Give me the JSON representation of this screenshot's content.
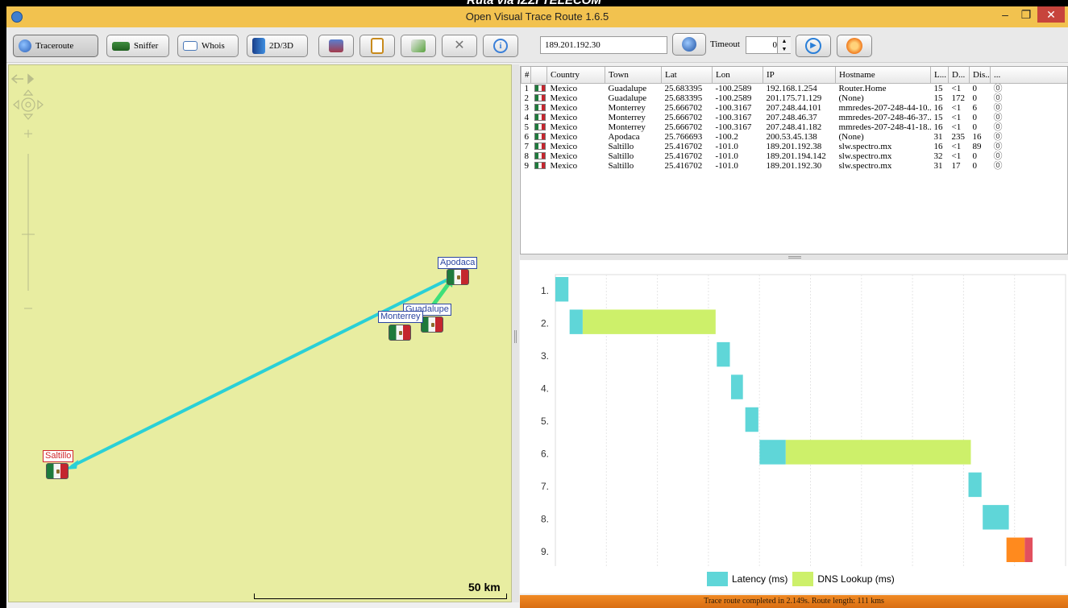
{
  "caption": "Ruta via IZZI TELECOM",
  "window": {
    "title": "Open Visual Trace Route 1.6.5",
    "minimize": "–",
    "maximize": "❐",
    "close": "✕"
  },
  "toolbar": {
    "traceroute_label": "Traceroute",
    "sniffer_label": "Sniffer",
    "whois_label": "Whois",
    "view_label": "2D/3D",
    "target_ip": "189.201.192.30",
    "timeout_label": "Timeout",
    "timeout_value": "0"
  },
  "map": {
    "scale_label": "50 km",
    "cities": {
      "apodaca": "Apodaca",
      "guadalupe": "Guadalupe",
      "monterrey": "Monterrey",
      "saltillo": "Saltillo"
    }
  },
  "table": {
    "columns": [
      "#",
      "",
      "Country",
      "Town",
      "Lat",
      "Lon",
      "IP",
      "Hostname",
      "L...",
      "D...",
      "Dis...",
      "..."
    ],
    "rows": [
      [
        "1",
        "Mexico",
        "Guadalupe",
        "25.683395",
        "-100.2589",
        "192.168.1.254",
        "Router.Home",
        "15",
        "<1",
        "0"
      ],
      [
        "2",
        "Mexico",
        "Guadalupe",
        "25.683395",
        "-100.2589",
        "201.175.71.129",
        "(None)",
        "15",
        "172",
        "0"
      ],
      [
        "3",
        "Mexico",
        "Monterrey",
        "25.666702",
        "-100.3167",
        "207.248.44.101",
        "mmredes-207-248-44-10...",
        "16",
        "<1",
        "6"
      ],
      [
        "4",
        "Mexico",
        "Monterrey",
        "25.666702",
        "-100.3167",
        "207.248.46.37",
        "mmredes-207-248-46-37...",
        "15",
        "<1",
        "0"
      ],
      [
        "5",
        "Mexico",
        "Monterrey",
        "25.666702",
        "-100.3167",
        "207.248.41.182",
        "mmredes-207-248-41-18...",
        "16",
        "<1",
        "0"
      ],
      [
        "6",
        "Mexico",
        "Apodaca",
        "25.766693",
        "-100.2",
        "200.53.45.138",
        "(None)",
        "31",
        "235",
        "16"
      ],
      [
        "7",
        "Mexico",
        "Saltillo",
        "25.416702",
        "-101.0",
        "189.201.192.38",
        "slw.spectro.mx",
        "16",
        "<1",
        "89"
      ],
      [
        "8",
        "Mexico",
        "Saltillo",
        "25.416702",
        "-101.0",
        "189.201.194.142",
        "slw.spectro.mx",
        "32",
        "<1",
        "0"
      ],
      [
        "9",
        "Mexico",
        "Saltillo",
        "25.416702",
        "-101.0",
        "189.201.192.30",
        "slw.spectro.mx",
        "31",
        "17",
        "0"
      ]
    ]
  },
  "chart_data": {
    "type": "bar",
    "orientation": "horizontal-gantt",
    "categories": [
      "1.",
      "2.",
      "3.",
      "4.",
      "5.",
      "6.",
      "7.",
      "8.",
      "9."
    ],
    "series": [
      {
        "name": "Latency (ms)",
        "start": [
          0,
          60,
          680,
          740,
          800,
          860,
          1740,
          1800,
          1900
        ],
        "duration": [
          55,
          55,
          55,
          50,
          55,
          110,
          55,
          110,
          110
        ]
      },
      {
        "name": "DNS Lookup (ms)",
        "start": [
          null,
          115,
          null,
          null,
          null,
          970,
          null,
          null,
          null
        ],
        "duration": [
          null,
          560,
          null,
          null,
          null,
          780,
          null,
          null,
          null
        ]
      }
    ],
    "xlim": [
      0,
      2149
    ],
    "grid": true,
    "legend": "bottom",
    "colors": {
      "latency": "#5fd6d8",
      "dns": "#cdf06a",
      "current_hop": "#ff8a1e",
      "current_hop_tail": "#e2505e"
    }
  },
  "status": {
    "text": "Trace route completed in 2.149s. Route length: 111 kms"
  }
}
